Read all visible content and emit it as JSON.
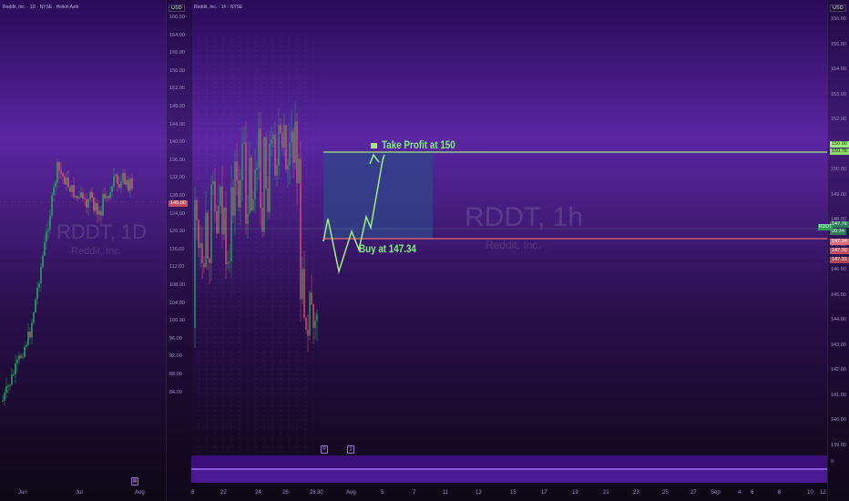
{
  "left_chart": {
    "legend": "Reddit, Inc. · 1D · NYSE · Heikin Ashi",
    "currency": "USD",
    "watermark_symbol": "RDDT, 1D",
    "watermark_name": "Reddit, Inc.",
    "price_ticks": [
      "166.00",
      "164.00",
      "160.00",
      "156.00",
      "152.00",
      "148.00",
      "144.00",
      "140.00",
      "136.00",
      "132.00",
      "128.00",
      "124.00",
      "120.00",
      "116.00",
      "112.00",
      "108.00",
      "104.00",
      "100.00",
      "96.00",
      "92.00",
      "88.00",
      "84.00"
    ],
    "time_labels": [
      "Jun",
      "Jul",
      "Aug"
    ],
    "current_price_tag": "145.00",
    "indicator_icon": "chart-icon"
  },
  "right_chart": {
    "legend": "Reddit, Inc. · 1h · NYSE",
    "currency": "USD",
    "watermark_symbol": "RDDT, 1h",
    "watermark_name": "Reddit, Inc.",
    "price_ticks": [
      "156.00",
      "155.00",
      "154.00",
      "153.00",
      "152.00",
      "151.00",
      "150.00",
      "149.00",
      "148.00",
      "147.00",
      "146.00",
      "145.00",
      "144.00",
      "143.00",
      "142.00",
      "141.00",
      "140.00",
      "139.00"
    ],
    "time_labels": [
      "8",
      "22",
      "24",
      "26",
      "28",
      "30",
      "Aug",
      "5",
      "7",
      "11",
      "13",
      "15",
      "17",
      "19",
      "21",
      "23",
      "25",
      "27",
      "Sep",
      "4",
      "6",
      "8",
      "10",
      "12"
    ],
    "annotations": {
      "take_profit": "Take Profit at 150",
      "buy": "Buy at 147.34"
    },
    "price_tags": {
      "tp_top": "150.00",
      "tp_bottom": "150.76",
      "symbol": "RDDT",
      "last": "147.76",
      "last_sub": "00:34",
      "buy": "147.34",
      "sl_top": "147.32",
      "sl_bottom": "147.31"
    },
    "volume_value": "0",
    "icons": [
      "alert-icon",
      "info-icon"
    ],
    "colors": {
      "up": "#22a85a",
      "down": "#e0506c",
      "profit_line": "#9df07a",
      "buy_line": "#e46a7a",
      "position_box": "#2d4688"
    }
  }
}
